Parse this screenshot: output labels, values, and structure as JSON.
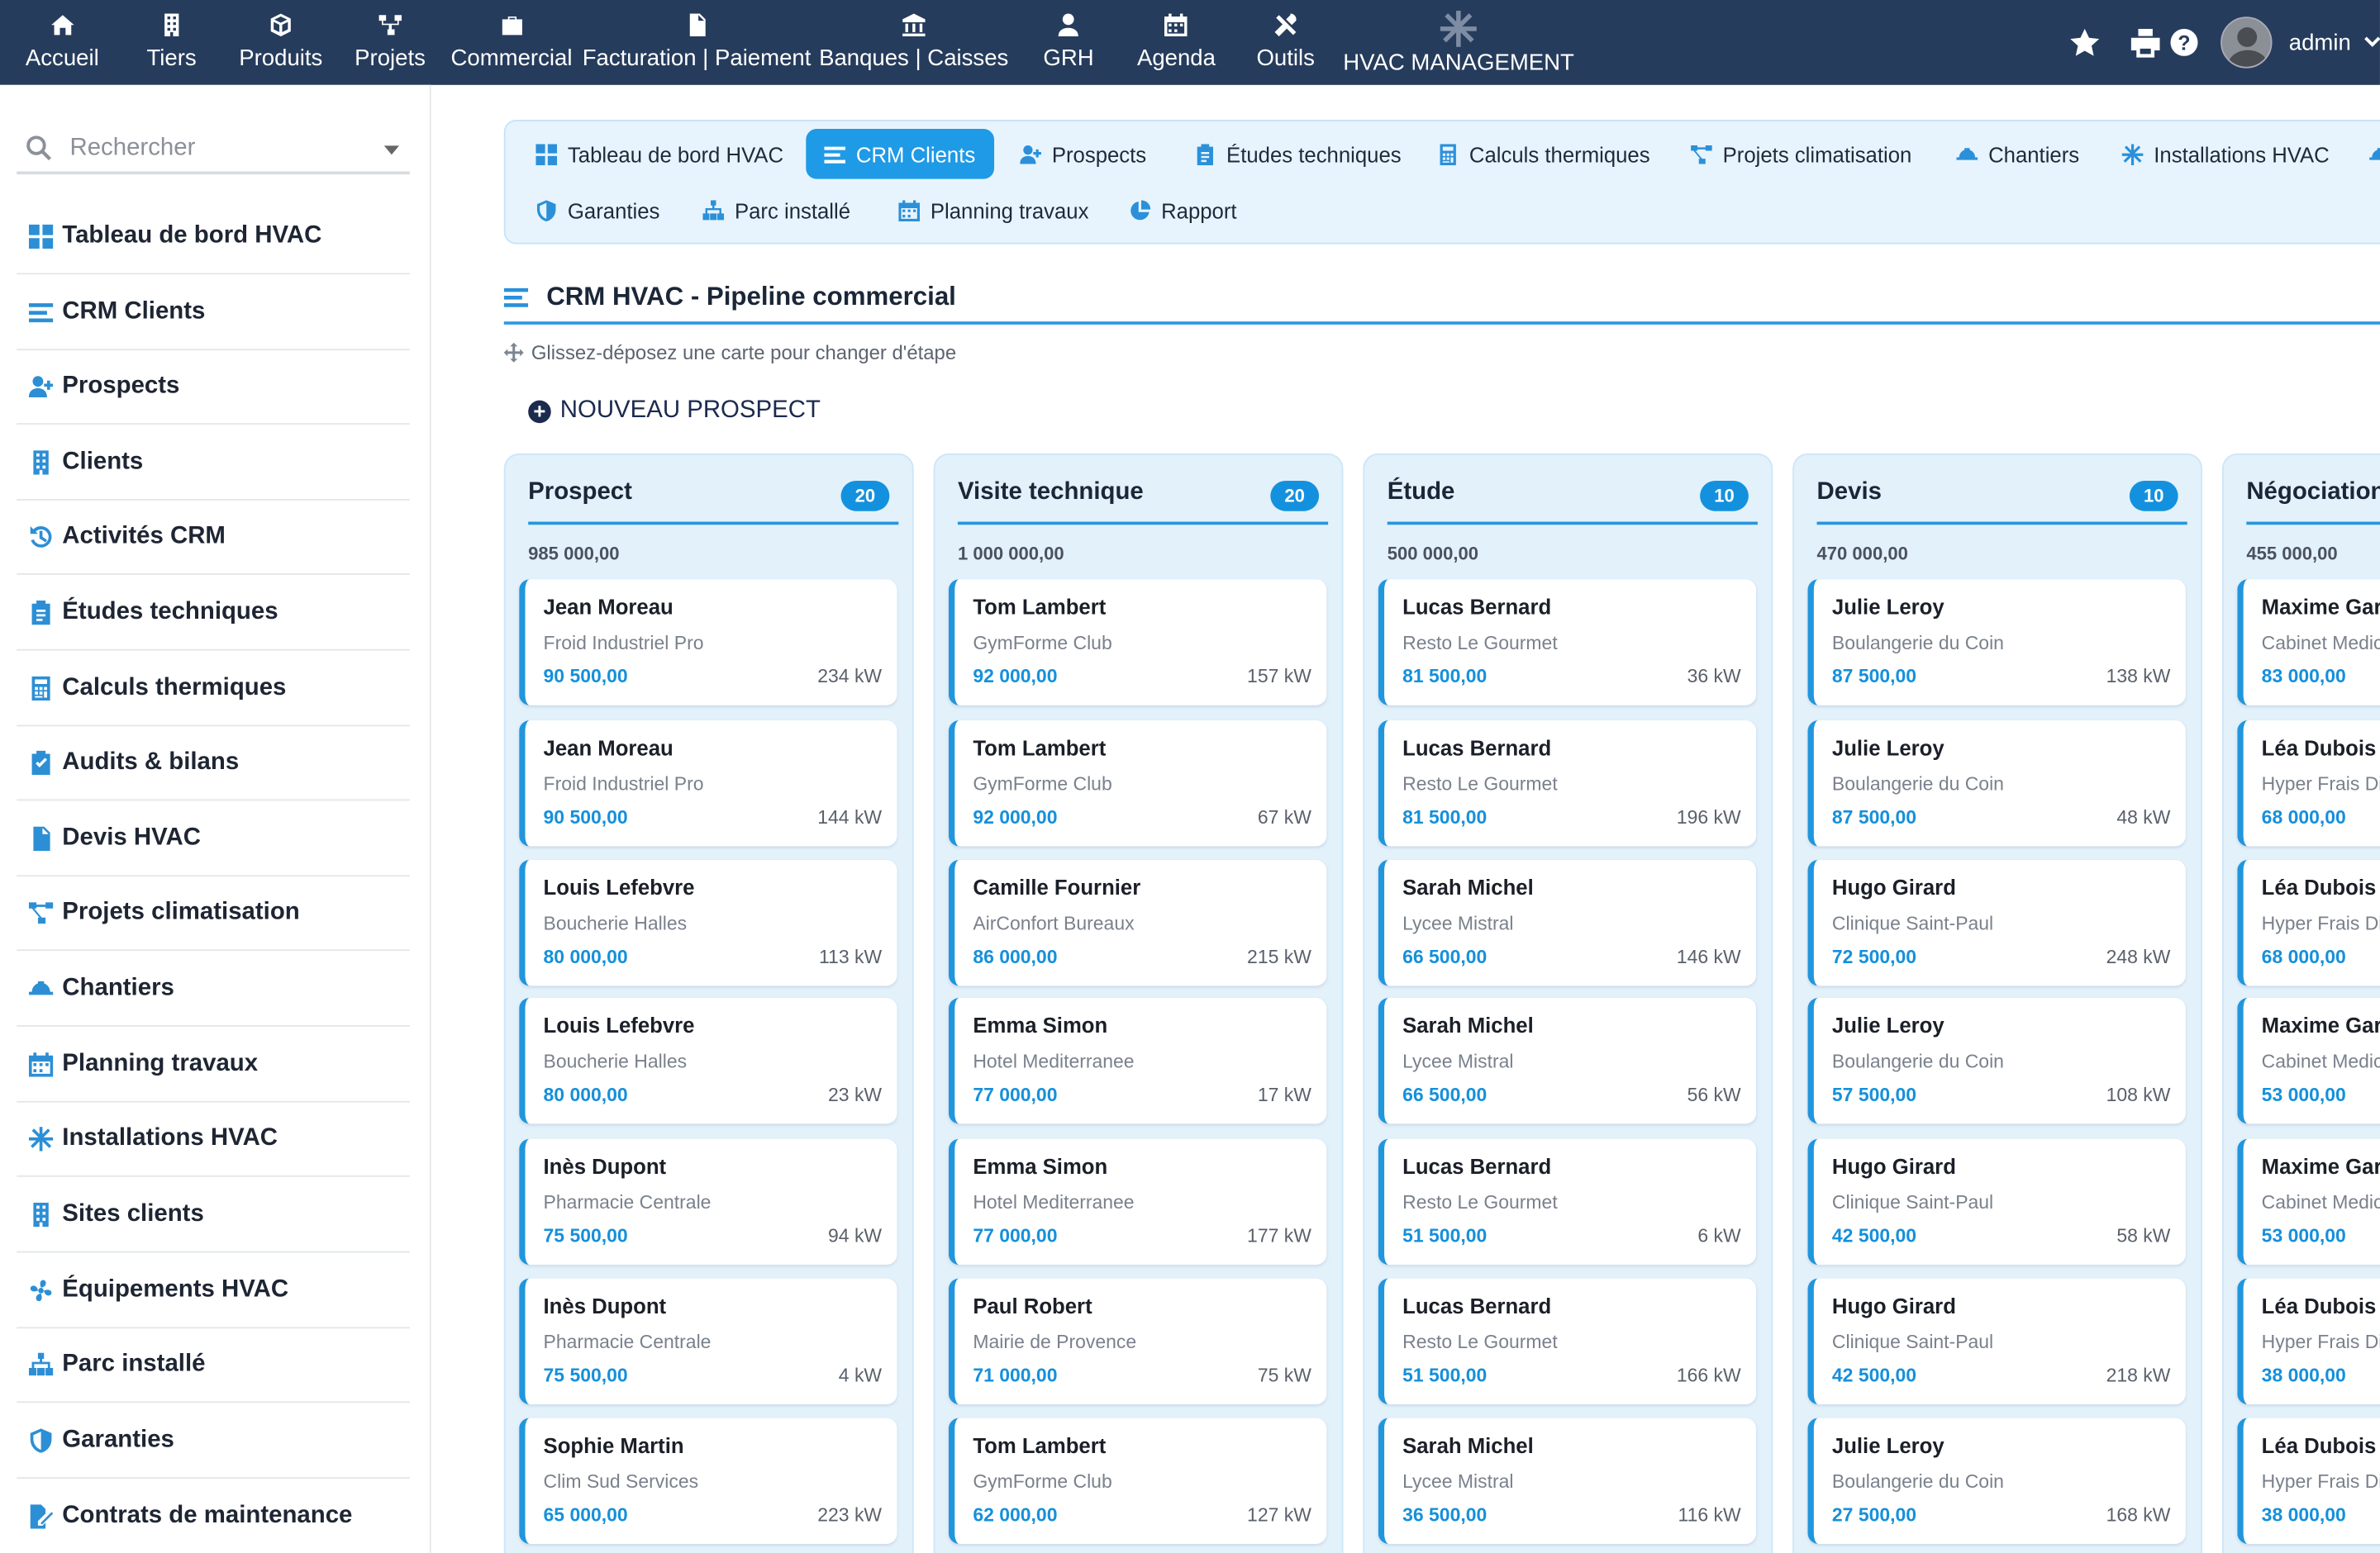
{
  "topnav": [
    {
      "label": "Accueil",
      "icon": "home-icon"
    },
    {
      "label": "Tiers",
      "icon": "building-icon"
    },
    {
      "label": "Produits",
      "icon": "cube-icon"
    },
    {
      "label": "Projets",
      "icon": "sitemap-icon"
    },
    {
      "label": "Commercial",
      "icon": "briefcase-icon"
    },
    {
      "label": "Facturation | Paiement",
      "icon": "invoice-icon"
    },
    {
      "label": "Banques | Caisses",
      "icon": "bank-icon"
    },
    {
      "label": "GRH",
      "icon": "user-tie-icon"
    },
    {
      "label": "Agenda",
      "icon": "calendar-icon"
    },
    {
      "label": "Outils",
      "icon": "tools-icon"
    },
    {
      "label": "HVAC MANAGEMENT",
      "icon": "snowflake-icon"
    }
  ],
  "topright": {
    "user": "admin",
    "icons": [
      "star-icon",
      "print-icon",
      "help-icon",
      "avatar",
      "chevron-down-icon"
    ]
  },
  "sidebar": {
    "search_placeholder": "Rechercher",
    "items": [
      {
        "label": "Tableau de bord HVAC",
        "icon": "dashboard-icon"
      },
      {
        "label": "CRM Clients",
        "icon": "list-icon"
      },
      {
        "label": "Prospects",
        "icon": "user-plus-icon"
      },
      {
        "label": "Clients",
        "icon": "building-icon"
      },
      {
        "label": "Activités CRM",
        "icon": "history-icon"
      },
      {
        "label": "Études techniques",
        "icon": "clipboard-list-icon"
      },
      {
        "label": "Calculs thermiques",
        "icon": "calculator-icon"
      },
      {
        "label": "Audits & bilans",
        "icon": "clipboard-check-icon"
      },
      {
        "label": "Devis HVAC",
        "icon": "invoice-icon"
      },
      {
        "label": "Projets climatisation",
        "icon": "project-diagram-icon"
      },
      {
        "label": "Chantiers",
        "icon": "hard-hat-icon"
      },
      {
        "label": "Planning travaux",
        "icon": "calendar-icon"
      },
      {
        "label": "Installations HVAC",
        "icon": "snowflake-icon"
      },
      {
        "label": "Sites clients",
        "icon": "building-icon"
      },
      {
        "label": "Équipements HVAC",
        "icon": "fan-icon"
      },
      {
        "label": "Parc installé",
        "icon": "network-icon"
      },
      {
        "label": "Garanties",
        "icon": "shield-icon"
      },
      {
        "label": "Contrats de maintenance",
        "icon": "file-signature-icon"
      }
    ]
  },
  "tabs": [
    {
      "label": "Tableau de bord HVAC",
      "icon": "dashboard-icon",
      "active": false
    },
    {
      "label": "CRM Clients",
      "icon": "list-icon",
      "active": true
    },
    {
      "label": "Prospects",
      "icon": "user-plus-icon",
      "active": false
    },
    {
      "label": "Études techniques",
      "icon": "clipboard-list-icon",
      "active": false
    },
    {
      "label": "Calculs thermiques",
      "icon": "calculator-icon",
      "active": false
    },
    {
      "label": "Projets climatisation",
      "icon": "project-diagram-icon",
      "active": false
    },
    {
      "label": "Chantiers",
      "icon": "hard-hat-icon",
      "active": false
    },
    {
      "label": "Installations HVAC",
      "icon": "snowflake-icon",
      "active": false
    },
    {
      "label": "Garanties",
      "icon": "shield-icon",
      "active": false
    },
    {
      "label": "Parc installé",
      "icon": "network-icon",
      "active": false
    },
    {
      "label": "Planning travaux",
      "icon": "calendar-icon",
      "active": false
    },
    {
      "label": "Rapport",
      "icon": "pie-chart-icon",
      "active": false
    }
  ],
  "page": {
    "title": "CRM HVAC - Pipeline commercial",
    "hint": "Glissez-déposez une carte pour changer d'étape",
    "new_button": "NOUVEAU PROSPECT"
  },
  "kanban": [
    {
      "name": "Prospect",
      "count": "20",
      "total": "985 000,00",
      "cards": [
        {
          "name": "Jean Moreau",
          "company": "Froid Industriel Pro",
          "amount": "90 500,00",
          "power": "234 kW"
        },
        {
          "name": "Jean Moreau",
          "company": "Froid Industriel Pro",
          "amount": "90 500,00",
          "power": "144 kW"
        },
        {
          "name": "Louis Lefebvre",
          "company": "Boucherie Halles",
          "amount": "80 000,00",
          "power": "113 kW"
        },
        {
          "name": "Louis Lefebvre",
          "company": "Boucherie Halles",
          "amount": "80 000,00",
          "power": "23 kW"
        },
        {
          "name": "Inès Dupont",
          "company": "Pharmacie Centrale",
          "amount": "75 500,00",
          "power": "94 kW"
        },
        {
          "name": "Inès Dupont",
          "company": "Pharmacie Centrale",
          "amount": "75 500,00",
          "power": "4 kW"
        },
        {
          "name": "Sophie Martin",
          "company": "Clim Sud Services",
          "amount": "65 000,00",
          "power": "223 kW"
        }
      ]
    },
    {
      "name": "Visite technique",
      "count": "20",
      "total": "1 000 000,00",
      "cards": [
        {
          "name": "Tom Lambert",
          "company": "GymForme Club",
          "amount": "92 000,00",
          "power": "157 kW"
        },
        {
          "name": "Tom Lambert",
          "company": "GymForme Club",
          "amount": "92 000,00",
          "power": "67 kW"
        },
        {
          "name": "Camille Fournier",
          "company": "AirConfort Bureaux",
          "amount": "86 000,00",
          "power": "215 kW"
        },
        {
          "name": "Emma Simon",
          "company": "Hotel Mediterranee",
          "amount": "77 000,00",
          "power": "17 kW"
        },
        {
          "name": "Emma Simon",
          "company": "Hotel Mediterranee",
          "amount": "77 000,00",
          "power": "177 kW"
        },
        {
          "name": "Paul Robert",
          "company": "Mairie de Provence",
          "amount": "71 000,00",
          "power": "75 kW"
        },
        {
          "name": "Tom Lambert",
          "company": "GymForme Club",
          "amount": "62 000,00",
          "power": "127 kW"
        }
      ]
    },
    {
      "name": "Étude",
      "count": "10",
      "total": "500 000,00",
      "cards": [
        {
          "name": "Lucas Bernard",
          "company": "Resto Le Gourmet",
          "amount": "81 500,00",
          "power": "36 kW"
        },
        {
          "name": "Lucas Bernard",
          "company": "Resto Le Gourmet",
          "amount": "81 500,00",
          "power": "196 kW"
        },
        {
          "name": "Sarah Michel",
          "company": "Lycee Mistral",
          "amount": "66 500,00",
          "power": "146 kW"
        },
        {
          "name": "Sarah Michel",
          "company": "Lycee Mistral",
          "amount": "66 500,00",
          "power": "56 kW"
        },
        {
          "name": "Lucas Bernard",
          "company": "Resto Le Gourmet",
          "amount": "51 500,00",
          "power": "6 kW"
        },
        {
          "name": "Lucas Bernard",
          "company": "Resto Le Gourmet",
          "amount": "51 500,00",
          "power": "166 kW"
        },
        {
          "name": "Sarah Michel",
          "company": "Lycee Mistral",
          "amount": "36 500,00",
          "power": "116 kW"
        }
      ]
    },
    {
      "name": "Devis",
      "count": "10",
      "total": "470 000,00",
      "cards": [
        {
          "name": "Julie Leroy",
          "company": "Boulangerie du Coin",
          "amount": "87 500,00",
          "power": "138 kW"
        },
        {
          "name": "Julie Leroy",
          "company": "Boulangerie du Coin",
          "amount": "87 500,00",
          "power": "48 kW"
        },
        {
          "name": "Hugo Girard",
          "company": "Clinique Saint-Paul",
          "amount": "72 500,00",
          "power": "248 kW"
        },
        {
          "name": "Julie Leroy",
          "company": "Boulangerie du Coin",
          "amount": "57 500,00",
          "power": "108 kW"
        },
        {
          "name": "Hugo Girard",
          "company": "Clinique Saint-Paul",
          "amount": "42 500,00",
          "power": "58 kW"
        },
        {
          "name": "Hugo Girard",
          "company": "Clinique Saint-Paul",
          "amount": "42 500,00",
          "power": "218 kW"
        },
        {
          "name": "Julie Leroy",
          "company": "Boulangerie du Coin",
          "amount": "27 500,00",
          "power": "168 kW"
        }
      ]
    },
    {
      "name": "Négociation",
      "count": "",
      "total": "455 000,00",
      "cards": [
        {
          "name": "Maxime Garnier",
          "company": "Cabinet Medical",
          "amount": "83 000,00",
          "power": ""
        },
        {
          "name": "Léa Dubois",
          "company": "Hyper Frais Distribution",
          "amount": "68 000,00",
          "power": ""
        },
        {
          "name": "Léa Dubois",
          "company": "Hyper Frais Distribution",
          "amount": "68 000,00",
          "power": ""
        },
        {
          "name": "Maxime Garnier",
          "company": "Cabinet Medical",
          "amount": "53 000,00",
          "power": ""
        },
        {
          "name": "Maxime Garnier",
          "company": "Cabinet Medical",
          "amount": "53 000,00",
          "power": ""
        },
        {
          "name": "Léa Dubois",
          "company": "Hyper Frais Distribution",
          "amount": "38 000,00",
          "power": ""
        },
        {
          "name": "Léa Dubois",
          "company": "Hyper Frais Distribution",
          "amount": "38 000,00",
          "power": ""
        }
      ]
    }
  ]
}
